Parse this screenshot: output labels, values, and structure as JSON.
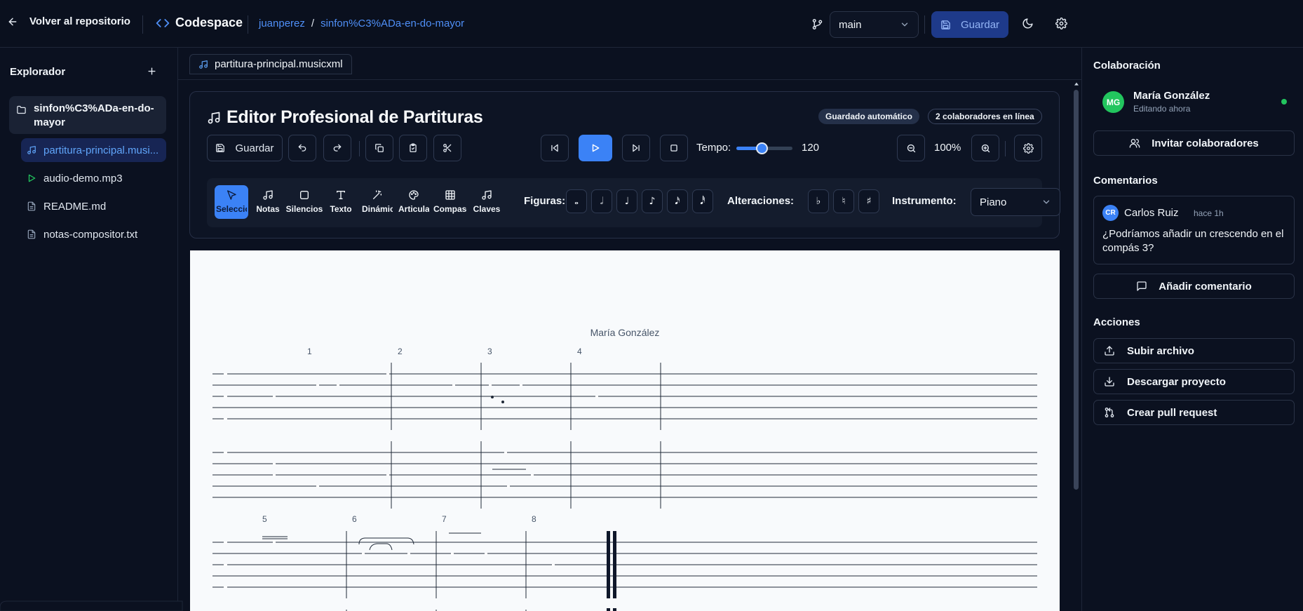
{
  "topbar": {
    "back_label": "Volver al repositorio",
    "app_name": "Codespace",
    "breadcrumb": {
      "owner": "juanperez",
      "separator": "/",
      "repo": "sinfon%C3%ADa-en-do-mayor"
    },
    "branch": "main",
    "save_label": "Guardar"
  },
  "sidebar": {
    "title": "Explorador",
    "folder": "sinfon%C3%ADa-en-do-mayor",
    "files": [
      {
        "name": "partitura-principal.musi...",
        "icon": "music-note-icon",
        "active": true
      },
      {
        "name": "audio-demo.mp3",
        "icon": "play-icon",
        "active": false
      },
      {
        "name": "README.md",
        "icon": "file-text-icon",
        "active": false
      },
      {
        "name": "notas-compositor.txt",
        "icon": "file-text-icon",
        "active": false
      }
    ]
  },
  "tab": {
    "label": "partitura-principal.musicxml"
  },
  "editor": {
    "title": "Editor Profesional de Partituras",
    "badges": {
      "autosave": "Guardado automático",
      "online": "2 colaboradores en línea"
    },
    "save_label": "Guardar",
    "tempo_label": "Tempo:",
    "tempo_value": "120",
    "tempo_slider_fraction": 0.45,
    "zoom_value": "100%",
    "tools": [
      {
        "label": "Seleccionar",
        "icon": "cursor-icon",
        "active": true
      },
      {
        "label": "Notas",
        "icon": "music-note-icon",
        "active": false
      },
      {
        "label": "Silencios",
        "icon": "square-icon",
        "active": false
      },
      {
        "label": "Texto",
        "icon": "text-icon",
        "active": false
      },
      {
        "label": "Dinámicas",
        "icon": "wand-icon",
        "active": false
      },
      {
        "label": "Articulaciones",
        "icon": "palette-icon",
        "active": false
      },
      {
        "label": "Compases",
        "icon": "grid-icon",
        "active": false
      },
      {
        "label": "Claves",
        "icon": "music-note-icon",
        "active": false
      }
    ],
    "figures_label": "Figuras:",
    "figures": [
      "𝅝",
      "𝅗𝅥",
      "♩",
      "♪",
      "𝅘𝅥𝅯",
      "𝅘𝅥𝅰"
    ],
    "accidentals_label": "Alteraciones:",
    "accidentals": [
      "♭",
      "♮",
      "♯"
    ],
    "instrument_label": "Instrumento:",
    "instrument": "Piano"
  },
  "score": {
    "author": "María González",
    "measures_row1": [
      "1",
      "2",
      "3",
      "4"
    ],
    "measures_row2": [
      "5",
      "6",
      "7",
      "8"
    ]
  },
  "right_panel": {
    "collab_title": "Colaboración",
    "collaborator": {
      "initials": "MG",
      "name": "María González",
      "status": "Editando ahora"
    },
    "invite_label": "Invitar colaboradores",
    "comments_title": "Comentarios",
    "comment": {
      "initials": "CR",
      "author": "Carlos Ruiz",
      "time": "hace 1h",
      "text": "¿Podríamos añadir un crescendo en el compás 3?"
    },
    "add_comment_label": "Añadir comentario",
    "actions_title": "Acciones",
    "actions": [
      {
        "label": "Subir archivo",
        "icon": "upload-icon"
      },
      {
        "label": "Descargar proyecto",
        "icon": "download-icon"
      },
      {
        "label": "Crear pull request",
        "icon": "git-pull-request-icon"
      }
    ]
  },
  "colors": {
    "accent": "#3b82f6",
    "background": "#0b1120",
    "online": "#22c55e"
  }
}
